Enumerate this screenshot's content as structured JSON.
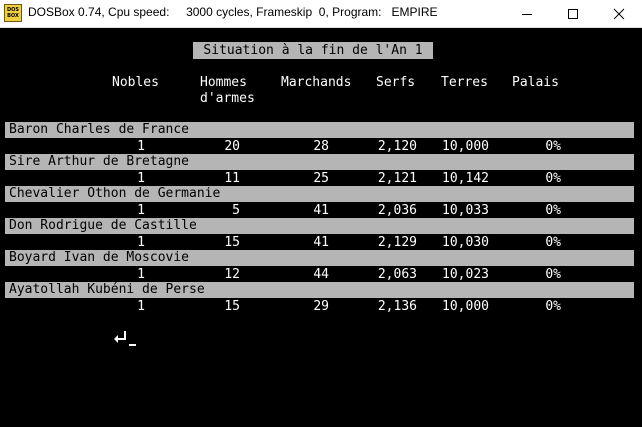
{
  "window": {
    "title": "DOSBox 0.74, Cpu speed:     3000 cycles, Frameskip  0, Program:   EMPIRE",
    "icon_label": [
      "DOS",
      "BOX"
    ],
    "icons": {
      "minimize": "minimize-icon",
      "maximize": "maximize-icon",
      "close": "close-icon"
    }
  },
  "game": {
    "heading": "Situation à la fin de l'An 1",
    "columns": {
      "nobles": "Nobles",
      "hommes": "Hommes\nd'armes",
      "marchands": "Marchands",
      "serfs": "Serfs",
      "terres": "Terres",
      "palais": "Palais"
    },
    "players": [
      {
        "name": "Baron Charles de France",
        "nobles": "1",
        "hommes": "20",
        "marchands": "28",
        "serfs": "2,120",
        "terres": "10,000",
        "palais": "0%"
      },
      {
        "name": "Sire Arthur de Bretagne",
        "nobles": "1",
        "hommes": "11",
        "marchands": "25",
        "serfs": "2,121",
        "terres": "10,142",
        "palais": "0%"
      },
      {
        "name": "Chevalier Othon de Germanie",
        "nobles": "1",
        "hommes": "5",
        "marchands": "41",
        "serfs": "2,036",
        "terres": "10,033",
        "palais": "0%"
      },
      {
        "name": "Don Rodrigue de Castille",
        "nobles": "1",
        "hommes": "15",
        "marchands": "41",
        "serfs": "2,129",
        "terres": "10,030",
        "palais": "0%"
      },
      {
        "name": "Boyard Ivan de Moscovie",
        "nobles": "1",
        "hommes": "12",
        "marchands": "44",
        "serfs": "2,063",
        "terres": "10,023",
        "palais": "0%"
      },
      {
        "name": "Ayatollah Kubéni de Perse",
        "nobles": "1",
        "hommes": "15",
        "marchands": "29",
        "serfs": "2,136",
        "terres": "10,000",
        "palais": "0%"
      }
    ],
    "prompt_icon": "enter-key-icon",
    "colors": {
      "bar": "#b5b5b5",
      "text": "#ffffff",
      "background": "#000000"
    }
  }
}
